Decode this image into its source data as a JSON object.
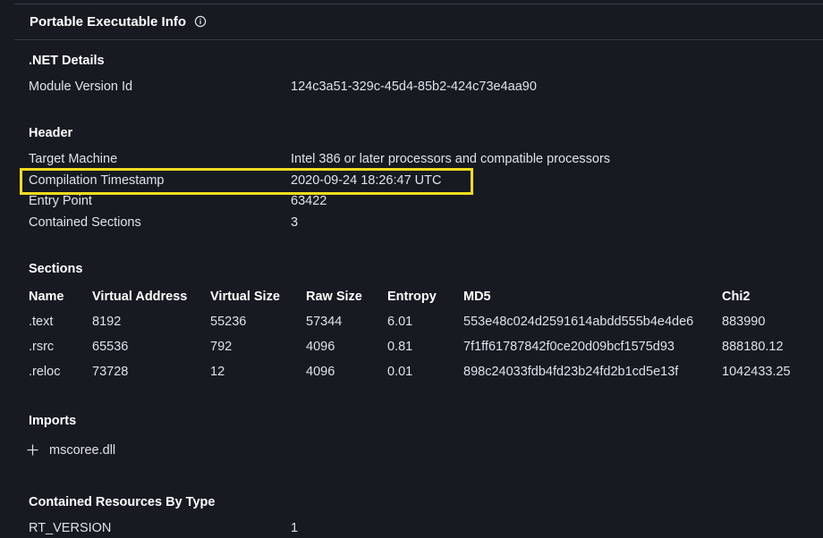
{
  "panel": {
    "title": "Portable Executable Info",
    "info_icon": "info-circle-icon"
  },
  "net_details": {
    "title": ".NET Details",
    "rows": [
      {
        "label": "Module Version Id",
        "value": "124c3a51-329c-45d4-85b2-424c73e4aa90"
      }
    ]
  },
  "header": {
    "title": "Header",
    "rows": [
      {
        "label": "Target Machine",
        "value": "Intel 386 or later processors and compatible processors"
      },
      {
        "label": "Compilation Timestamp",
        "value": "2020-09-24 18:26:47 UTC"
      },
      {
        "label": "Entry Point",
        "value": "63422"
      },
      {
        "label": "Contained Sections",
        "value": "3"
      }
    ],
    "highlight_color": "#f1dc1f"
  },
  "sections": {
    "title": "Sections",
    "columns": [
      "Name",
      "Virtual Address",
      "Virtual Size",
      "Raw Size",
      "Entropy",
      "MD5",
      "Chi2"
    ],
    "rows": [
      [
        ".text",
        "8192",
        "55236",
        "57344",
        "6.01",
        "553e48c024d2591614abdd555b4e4de6",
        "883990"
      ],
      [
        ".rsrc",
        "65536",
        "792",
        "4096",
        "0.81",
        "7f1ff61787842f0ce20d09bcf1575d93",
        "888180.12"
      ],
      [
        ".reloc",
        "73728",
        "12",
        "4096",
        "0.01",
        "898c24033fdb4fd23b24fd2b1cd5e13f",
        "1042433.25"
      ]
    ]
  },
  "imports": {
    "title": "Imports",
    "expand_icon": "plus-icon",
    "items": [
      {
        "name": "mscoree.dll"
      }
    ]
  },
  "resources": {
    "title": "Contained Resources By Type",
    "rows": [
      {
        "label": "RT_VERSION",
        "value": "1"
      }
    ]
  }
}
